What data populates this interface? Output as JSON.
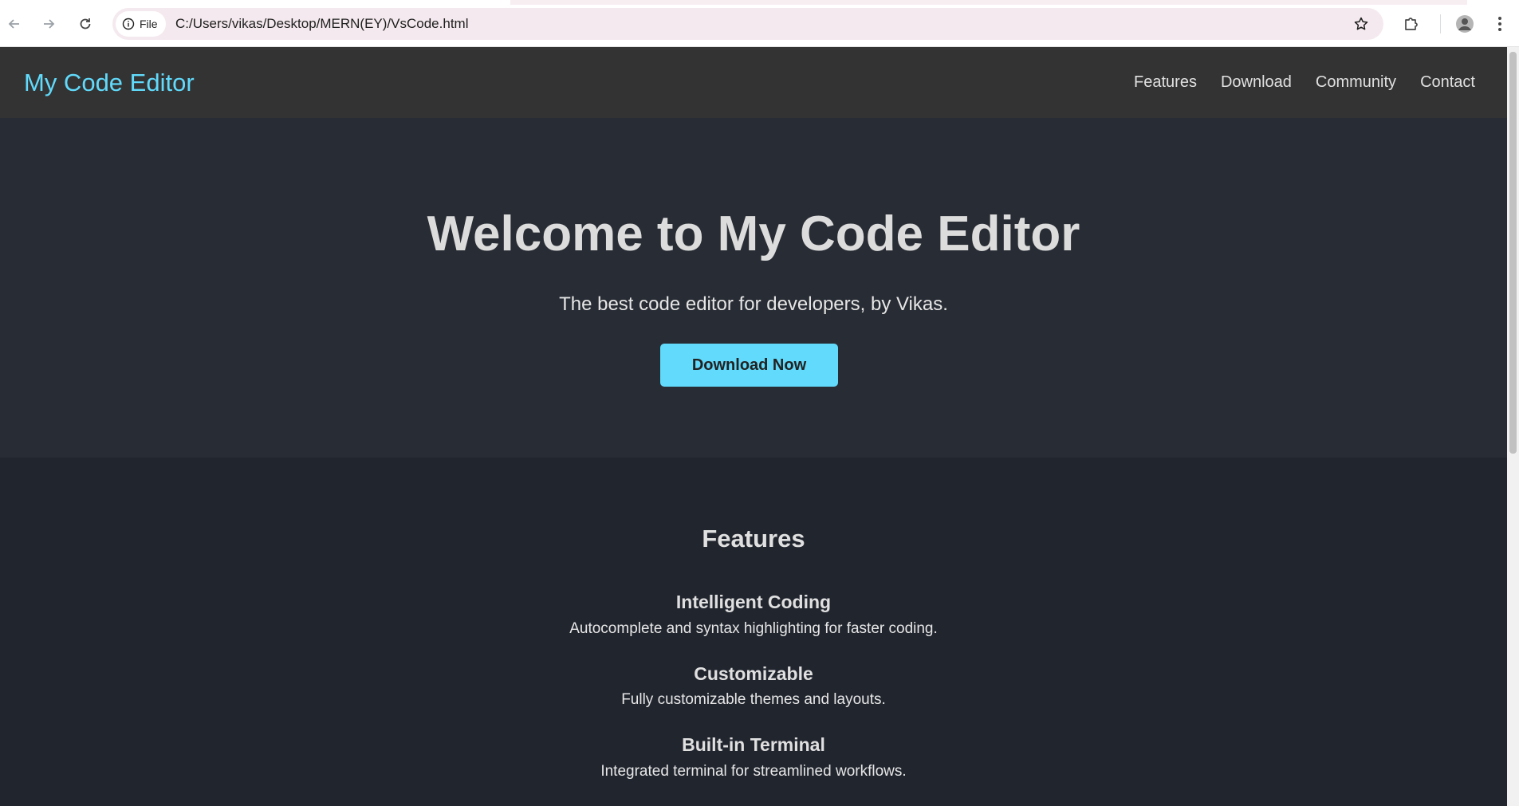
{
  "browser": {
    "back_icon": "arrow-left-icon",
    "forward_icon": "arrow-right-icon",
    "reload_icon": "reload-icon",
    "file_chip_label": "File",
    "url": "C:/Users/vikas/Desktop/MERN(EY)/VsCode.html",
    "bookmark_icon": "star-icon",
    "extensions_icon": "puzzle-icon",
    "profile_icon": "avatar-icon",
    "menu_icon": "kebab-menu-icon"
  },
  "site": {
    "logo": "My Code Editor",
    "nav": [
      {
        "label": "Features"
      },
      {
        "label": "Download"
      },
      {
        "label": "Community"
      },
      {
        "label": "Contact"
      }
    ],
    "hero": {
      "title": "Welcome to My Code Editor",
      "subtitle": "The best code editor for developers, by Vikas.",
      "cta_label": "Download Now"
    },
    "features": {
      "heading": "Features",
      "items": [
        {
          "title": "Intelligent Coding",
          "desc": "Autocomplete and syntax highlighting for faster coding."
        },
        {
          "title": "Customizable",
          "desc": "Fully customizable themes and layouts."
        },
        {
          "title": "Built-in Terminal",
          "desc": "Integrated terminal for streamlined workflows."
        }
      ]
    }
  },
  "colors": {
    "accent": "#61dafb",
    "header_bg": "#333333",
    "hero_bg": "#282c34",
    "features_bg": "#21252e"
  }
}
